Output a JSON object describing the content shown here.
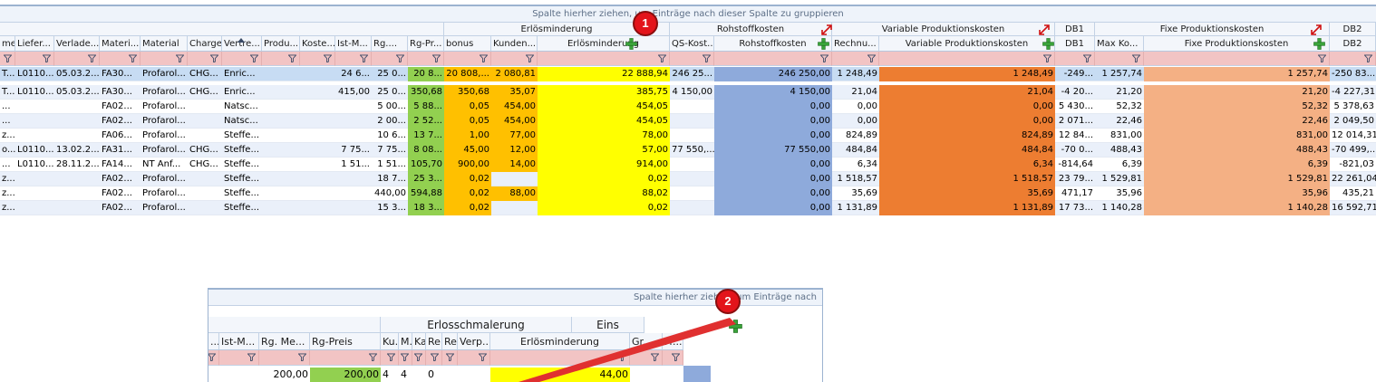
{
  "colors": {
    "orange": "#ffc000",
    "yellow": "#ffff00",
    "blue": "#8eaadb",
    "dark_orange": "#ed7d31",
    "salmon": "#f4b084",
    "green": "#92d050",
    "badge": "#e3141b",
    "arrow": "#e03030"
  },
  "icons": {
    "filter": "funnel-icon",
    "add": "green-plus-icon",
    "expand": "red-diagonal-expand-icon",
    "sort": "sort-ascending-icon"
  },
  "grid1": {
    "group_panel_text": "Spalte hierher ziehen, um Einträge nach dieser Spalte zu gruppieren",
    "bands": {
      "erlosminderung": "Erlösminderung",
      "rohstoffkosten": "Rohstoffkosten",
      "variable": "Variable Produktionskosten",
      "db1": "DB1",
      "fixe": "Fixe Produktionskosten",
      "db2": "DB2"
    },
    "headers": {
      "c0": "me",
      "c1": "Liefer...",
      "c2": "Verlade...",
      "c3": "Materi...",
      "c4": "Material",
      "c5": "Charge",
      "c6": "Vertre...",
      "c7": "Produ...",
      "c8": "Koste...",
      "c9": "Ist-M...",
      "c10": "Rg....",
      "c11": "Rg-Pr...",
      "c12": "bonus",
      "c13": "Kunden...",
      "c14": "Erlösminderung",
      "c15": "QS-Kost...",
      "c16": "Rohstoffkosten",
      "c17": "Rechnu...",
      "c18": "Variable Produktionskosten",
      "c19": "DB1",
      "c20": "Max Ko...",
      "c21": "Fixe Produktionskosten",
      "c22": "DB2"
    },
    "rows": [
      [
        "T...",
        "L0110...",
        "05.03.2...",
        "FA30...",
        "Profarol...",
        "CHG...",
        "Enric...",
        "",
        "",
        "24 6...",
        "25 0...",
        "20 8...",
        "20 808,...",
        "2 080,81",
        "22 888,94",
        "246 25...",
        "246 250,00",
        "1 248,49",
        "1 248,49",
        "-249...",
        "1 257,74",
        "1 257,74",
        "-250 83..."
      ],
      [
        "T...",
        "L0110...",
        "05.03.2...",
        "FA30...",
        "Profarol...",
        "CHG...",
        "Enric...",
        "",
        "",
        "415,00",
        "25 0...",
        "350,68",
        "350,68",
        "35,07",
        "385,75",
        "4 150,00",
        "4 150,00",
        "21,04",
        "21,04",
        "-4 20...",
        "21,20",
        "21,20",
        "-4 227,31"
      ],
      [
        "...",
        "",
        "",
        "FA02...",
        "Profarol...",
        "",
        "Natsc...",
        "",
        "",
        "",
        "5 00...",
        "5 88...",
        "0,05",
        "454,00",
        "454,05",
        "",
        "0,00",
        "0,00",
        "0,00",
        "5 430...",
        "52,32",
        "52,32",
        "5 378,63"
      ],
      [
        "...",
        "",
        "",
        "FA02...",
        "Profarol...",
        "",
        "Natsc...",
        "",
        "",
        "",
        "2 00...",
        "2 52...",
        "0,05",
        "454,00",
        "454,05",
        "",
        "0,00",
        "0,00",
        "0,00",
        "2 071...",
        "22,46",
        "22,46",
        "2 049,50"
      ],
      [
        "z...",
        "",
        "",
        "FA06...",
        "Profarol...",
        "",
        "Steffe...",
        "",
        "",
        "",
        "10 6...",
        "13 7...",
        "1,00",
        "77,00",
        "78,00",
        "",
        "0,00",
        "824,89",
        "824,89",
        "12 84...",
        "831,00",
        "831,00",
        "12 014,31"
      ],
      [
        "o...",
        "L0110...",
        "13.02.2...",
        "FA31...",
        "Profarol...",
        "CHG...",
        "Steffe...",
        "",
        "",
        "7 75...",
        "7 75...",
        "8 08...",
        "45,00",
        "12,00",
        "57,00",
        "77 550,...",
        "77 550,00",
        "484,84",
        "484,84",
        "-70 0...",
        "488,43",
        "488,43",
        "-70 499,..."
      ],
      [
        "...",
        "L0110...",
        "28.11.2...",
        "FA14...",
        "NT Anf...",
        "CHG...",
        "Steffe...",
        "",
        "",
        "1 51...",
        "1 51...",
        "105,70",
        "900,00",
        "14,00",
        "914,00",
        "",
        "0,00",
        "6,34",
        "6,34",
        "-814,64",
        "6,39",
        "6,39",
        "-821,03"
      ],
      [
        "z...",
        "",
        "",
        "FA02...",
        "Profarol...",
        "",
        "Steffe...",
        "",
        "",
        "",
        "18 7...",
        "25 3...",
        "0,02",
        "",
        "0,02",
        "",
        "0,00",
        "1 518,57",
        "1 518,57",
        "23 79...",
        "1 529,81",
        "1 529,81",
        "22 261,04"
      ],
      [
        "z...",
        "",
        "",
        "FA02...",
        "Profarol...",
        "",
        "Steffe...",
        "",
        "",
        "",
        "440,00",
        "594,88",
        "0,02",
        "88,00",
        "88,02",
        "",
        "0,00",
        "35,69",
        "35,69",
        "471,17",
        "35,96",
        "35,96",
        "435,21"
      ],
      [
        "z...",
        "",
        "",
        "FA02...",
        "Profarol...",
        "",
        "Steffe...",
        "",
        "",
        "",
        "15 3...",
        "18 3...",
        "0,02",
        "",
        "0,02",
        "",
        "0,00",
        "1 131,89",
        "1 131,89",
        "17 73...",
        "1 140,28",
        "1 140,28",
        "16 592,71"
      ]
    ]
  },
  "grid2": {
    "group_panel_text": "Spalte hierher ziehen, um Einträge nach",
    "bands": {
      "erlosschmalerung": "Erlosschmalerung",
      "eins": "Eins"
    },
    "headers": {
      "d0": "...",
      "d1": "Ist-M...",
      "d2": "Rg. Me...",
      "d3": "Rg-Preis",
      "d4": "Ku...",
      "d5": "M...",
      "d6": "Ka...",
      "d7": "Re...",
      "d8": "Re...",
      "d9": "Verp...",
      "d10": "Erlösminderung",
      "d11": "Gr...",
      "d12": "Fr..."
    },
    "row": [
      "",
      "",
      "200,00",
      "200,00",
      "4",
      "4",
      "",
      "0",
      "",
      "",
      "44,00",
      "",
      ""
    ]
  },
  "annotations": {
    "badge1": "1",
    "badge2": "2"
  }
}
